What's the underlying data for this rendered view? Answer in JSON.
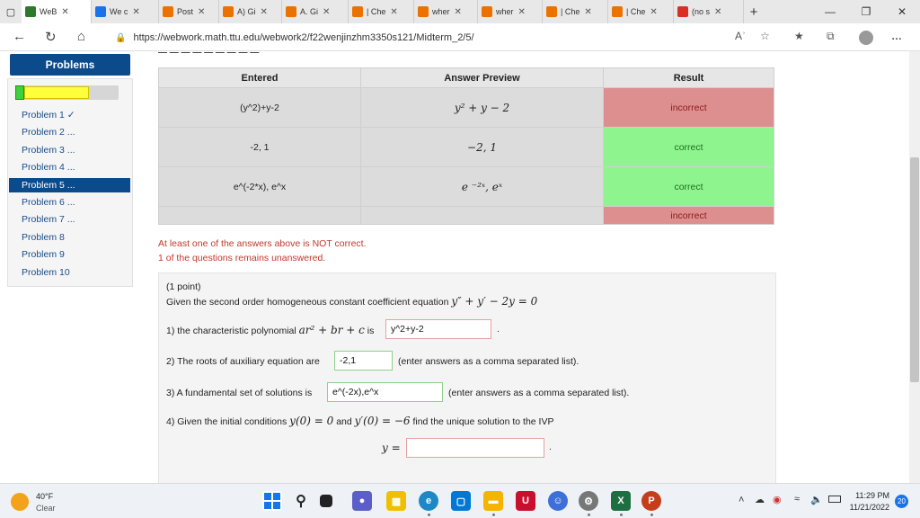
{
  "browser": {
    "tabs": [
      {
        "label": "WeB",
        "icon": "webwork-icon",
        "color": "#2d7a2d",
        "active": true
      },
      {
        "label": "We c",
        "icon": "search-icon",
        "color": "#1a73e8",
        "active": false
      },
      {
        "label": "Post",
        "icon": "chegg-icon",
        "color": "#eb7100",
        "active": false
      },
      {
        "label": "A) Gi",
        "icon": "chegg-icon",
        "color": "#eb7100",
        "active": false
      },
      {
        "label": "A. Gi",
        "icon": "chegg-icon",
        "color": "#eb7100",
        "active": false
      },
      {
        "label": "| Che",
        "icon": "chegg-icon",
        "color": "#eb7100",
        "active": false
      },
      {
        "label": "wher",
        "icon": "chegg-icon",
        "color": "#eb7100",
        "active": false
      },
      {
        "label": "wher",
        "icon": "chegg-icon",
        "color": "#eb7100",
        "active": false
      },
      {
        "label": "| Che",
        "icon": "chegg-icon",
        "color": "#eb7100",
        "active": false
      },
      {
        "label": "| Che",
        "icon": "chegg-icon",
        "color": "#eb7100",
        "active": false
      },
      {
        "label": "(no s",
        "icon": "gmail-icon",
        "color": "#d93025",
        "active": false
      }
    ],
    "url": "https://webwork.math.ttu.edu/webwork2/f22wenjinzhm3350s121/Midterm_2/5/",
    "read_aloud": "Aʾ"
  },
  "page": {
    "cutoff_heading": "— — — — — — — — —",
    "sidebar": {
      "title": "Problems",
      "items": [
        "Problem 1 ✓",
        "Problem 2 ...",
        "Problem 3 ...",
        "Problem 4 ...",
        "Problem 5 ...",
        "Problem 6 ...",
        "Problem 7 ...",
        "Problem 8",
        "Problem 9",
        "Problem 10"
      ],
      "active_index": 4,
      "progress_fraction": 0.6
    },
    "results": {
      "headers": [
        "Entered",
        "Answer Preview",
        "Result"
      ],
      "rows": [
        {
          "entered": "(y^2)+y-2",
          "preview": "y² + y − 2",
          "result": "incorrect",
          "status": "bad"
        },
        {
          "entered": "-2, 1",
          "preview": "−2, 1",
          "result": "correct",
          "status": "good"
        },
        {
          "entered": "e^(-2*x), e^x",
          "preview": "e ⁻²ˣ, eˣ",
          "result": "correct",
          "status": "good"
        },
        {
          "entered": "",
          "preview": "",
          "result": "incorrect",
          "status": "bad"
        }
      ]
    },
    "messages": {
      "not_correct": "At least one of the answers above is NOT correct.",
      "unanswered": "1 of the questions remains unanswered."
    },
    "problem": {
      "points": "(1 point)",
      "intro": "Given the second order homogeneous constant coefficient equation",
      "equation": "y″ + y′ − 2y = 0",
      "q1_prefix": "1) the characteristic polynomial",
      "q1_math": "ar² + br + c",
      "q1_is": "is",
      "q1_value": "y^2+y-2",
      "q1_suffix": ".",
      "q2_prefix": "2) The roots of auxiliary equation are",
      "q2_value": "-2,1",
      "q2_suffix": "(enter answers as a comma separated list).",
      "q3_prefix": "3) A fundamental set of solutions is",
      "q3_value": "e^(-2x),e^x",
      "q3_suffix": "(enter answers as a comma separated list).",
      "q4_prefix": "4) Given the initial conditions",
      "q4_cond1": "y(0) = 0",
      "q4_and": "and",
      "q4_cond2": "y′(0) = −6",
      "q4_suffix": "find the unique solution to the IVP",
      "y_label": "y =",
      "y_value": "",
      "y_suffix": "."
    }
  },
  "taskbar": {
    "weather_temp": "40°F",
    "weather_desc": "Clear",
    "time": "11:29 PM",
    "date": "11/21/2022",
    "notif_count": "20"
  }
}
